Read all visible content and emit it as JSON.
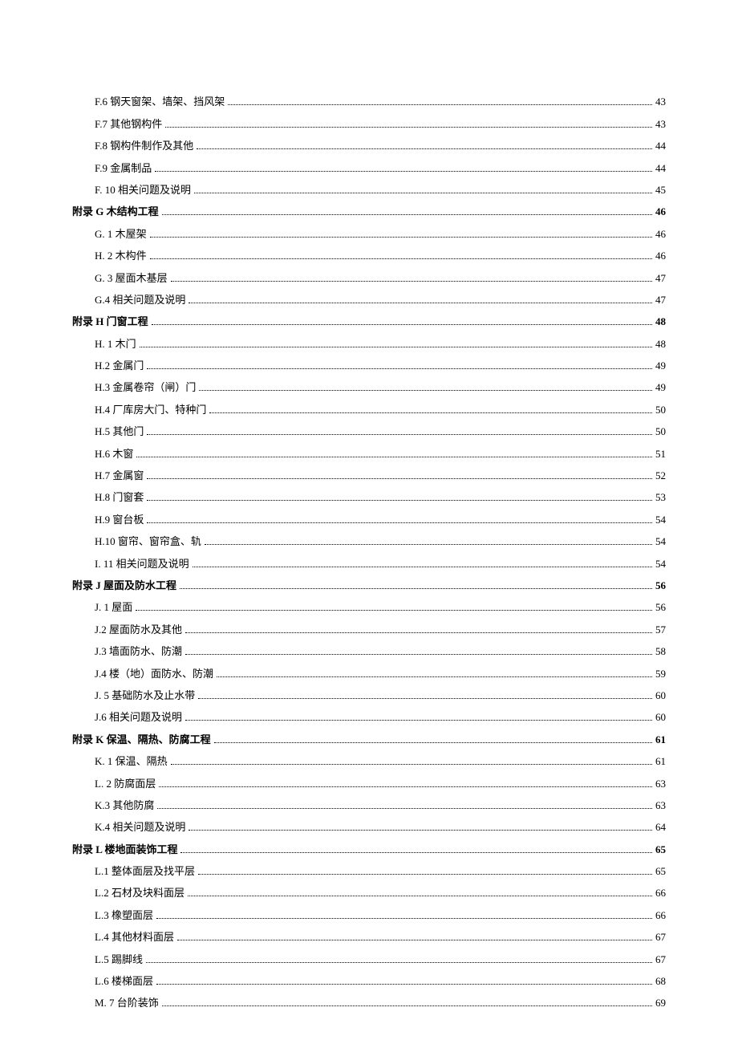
{
  "toc": [
    {
      "label": "F.6 钢天窗架、墙架、挡风架",
      "page": "43",
      "level": 1,
      "section": false
    },
    {
      "label": "F.7 其他钢构件",
      "page": "43",
      "level": 1,
      "section": false
    },
    {
      "label": "F.8 钢构件制作及其他",
      "page": "44",
      "level": 1,
      "section": false
    },
    {
      "label": "F.9 金属制品",
      "page": "44",
      "level": 1,
      "section": false
    },
    {
      "label": "F.   10 相关问题及说明",
      "page": "45",
      "level": 1,
      "section": false
    },
    {
      "label": "附录 G 木结构工程",
      "page": "46",
      "level": 0,
      "section": true
    },
    {
      "label": "G.   1 木屋架",
      "page": "46",
      "level": 1,
      "section": false
    },
    {
      "label": "H.   2  木构件",
      "page": "46",
      "level": 1,
      "section": false
    },
    {
      "label": "G.   3 屋面木基层",
      "page": "47",
      "level": 1,
      "section": false
    },
    {
      "label": "G.4 相关问题及说明",
      "page": "47",
      "level": 1,
      "section": false
    },
    {
      "label": "附录 H 门窗工程",
      "page": "48",
      "level": 0,
      "section": true
    },
    {
      "label": "H.   1  木门",
      "page": "48",
      "level": 1,
      "section": false
    },
    {
      "label": "H.2 金属门",
      "page": "49",
      "level": 1,
      "section": false
    },
    {
      "label": "H.3 金属卷帘（闸）门",
      "page": "49",
      "level": 1,
      "section": false
    },
    {
      "label": "H.4 厂库房大门、特种门",
      "page": "50",
      "level": 1,
      "section": false
    },
    {
      "label": "H.5 其他门",
      "page": "50",
      "level": 1,
      "section": false
    },
    {
      "label": "H.6      木窗",
      "page": "51",
      "level": 1,
      "section": false
    },
    {
      "label": "H.7 金属窗",
      "page": "52",
      "level": 1,
      "section": false
    },
    {
      "label": "H.8      门窗套",
      "page": "53",
      "level": 1,
      "section": false
    },
    {
      "label": "H.9      窗台板",
      "page": "54",
      "level": 1,
      "section": false
    },
    {
      "label": "H.10 窗帘、窗帘盒、轨",
      "page": "54",
      "level": 1,
      "section": false
    },
    {
      "label": "I.    11 相关问题及说明",
      "page": "54",
      "level": 1,
      "section": false
    },
    {
      "label": "附录 J 屋面及防水工程",
      "page": "56",
      "level": 0,
      "section": true
    },
    {
      "label": "J.   1 屋面",
      "page": "56",
      "level": 1,
      "section": false
    },
    {
      "label": "J.2 屋面防水及其他",
      "page": "57",
      "level": 1,
      "section": false
    },
    {
      "label": "J.3 墙面防水、防潮",
      "page": "58",
      "level": 1,
      "section": false
    },
    {
      "label": "J.4 楼（地）面防水、防潮",
      "page": "59",
      "level": 1,
      "section": false
    },
    {
      "label": "J.    5 基础防水及止水带",
      "page": "60",
      "level": 1,
      "section": false
    },
    {
      "label": "J.6 相关问题及说明",
      "page": "60",
      "level": 1,
      "section": false
    },
    {
      "label": "附录 K 保温、隔热、防腐工程",
      "page": "61",
      "level": 0,
      "section": true
    },
    {
      "label": "K.   1 保温、隔热",
      "page": "61",
      "level": 1,
      "section": false
    },
    {
      "label": "L.    2 防腐面层",
      "page": "63",
      "level": 1,
      "section": false
    },
    {
      "label": "K.3 其他防腐",
      "page": "63",
      "level": 1,
      "section": false
    },
    {
      "label": "K.4 相关问题及说明",
      "page": "64",
      "level": 1,
      "section": false
    },
    {
      "label": "附录 L 楼地面装饰工程",
      "page": "65",
      "level": 0,
      "section": true
    },
    {
      "label": "L.1 整体面层及找平层",
      "page": "65",
      "level": 1,
      "section": false
    },
    {
      "label": "L.2      石材及块料面层",
      "page": "66",
      "level": 1,
      "section": false
    },
    {
      "label": "L.3 橡塑面层",
      "page": "66",
      "level": 1,
      "section": false
    },
    {
      "label": "L.4 其他材料面层",
      "page": "67",
      "level": 1,
      "section": false
    },
    {
      "label": "L.5 踢脚线",
      "page": "67",
      "level": 1,
      "section": false
    },
    {
      "label": "L.6 楼梯面层",
      "page": "68",
      "level": 1,
      "section": false
    },
    {
      "label": "M.   7 台阶装饰",
      "page": "69",
      "level": 1,
      "section": false
    }
  ]
}
